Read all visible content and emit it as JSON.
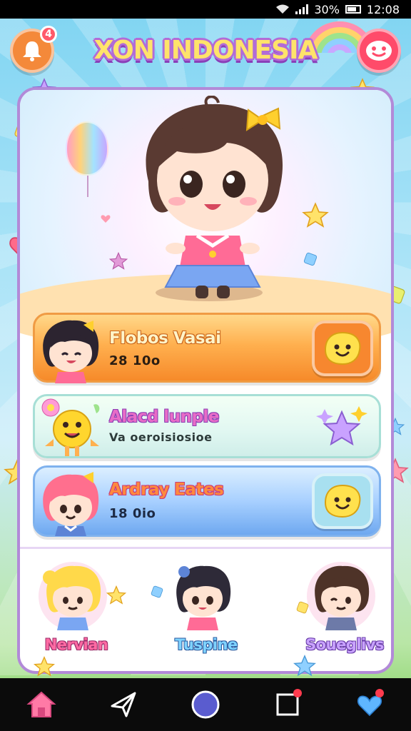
{
  "status_bar": {
    "battery_text": "30%",
    "time": "12:08"
  },
  "header": {
    "title": "XON INDONESIA",
    "notification_count": "4"
  },
  "rows": [
    {
      "title": "Flobos Vasai",
      "subtitle": "28 10o",
      "action_icon": "smiley-icon",
      "color": "#f68a2a"
    },
    {
      "title": "Alacd lunple",
      "subtitle": "Va oeroisiosioe",
      "action_icon": "star-icon",
      "color": "#cfeee9"
    },
    {
      "title": "Ardray Eates",
      "subtitle": "18 0io",
      "action_icon": "smiley-icon",
      "color": "#6ea8f0"
    }
  ],
  "characters": [
    {
      "name": "Nervian"
    },
    {
      "name": "Tuspine"
    },
    {
      "name": "Soueglivs"
    }
  ],
  "bottom_nav": [
    {
      "icon": "home-icon",
      "active": true
    },
    {
      "icon": "paper-plane-icon",
      "active": false
    },
    {
      "icon": "circle-icon",
      "active": false
    },
    {
      "icon": "square-icon",
      "active": false
    },
    {
      "icon": "heart-icon",
      "active": false
    }
  ],
  "colors": {
    "accent": "#b28ad8",
    "title_fill": "#ffe36a",
    "notif_button": "#f4893a",
    "profile_button": "#ff4b6a"
  }
}
